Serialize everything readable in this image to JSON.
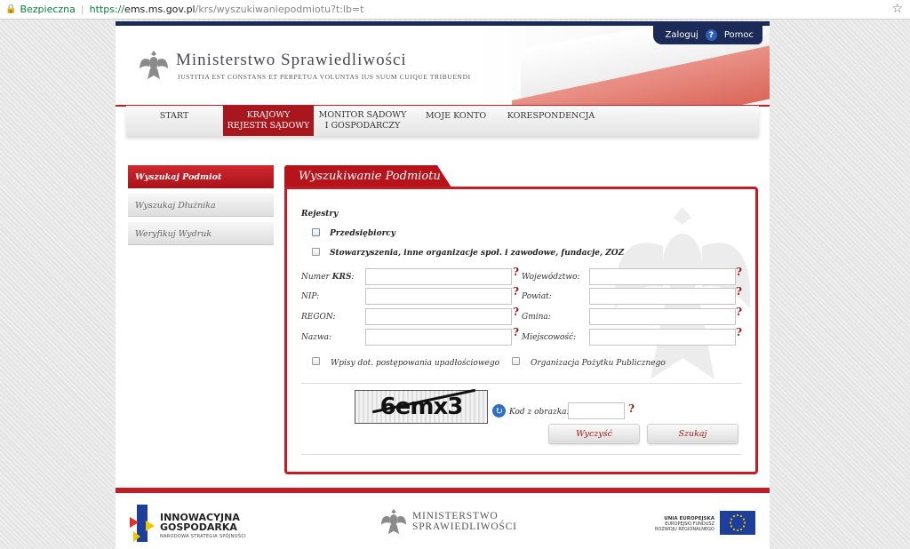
{
  "browser": {
    "secure_label": "Bezpieczna",
    "url_protocol": "https://",
    "url_host": "ems.ms.gov.pl",
    "url_path": "/krs/wyszukiwaniepodmiotu?t:lb=t"
  },
  "header": {
    "title": "Ministerstwo Sprawiedliwości",
    "motto": "IUSTITIA EST CONSTANS ET PERPETUA VOLUNTAS IUS SUUM CUIQUE TRIBUENDI",
    "login_label": "Zaloguj",
    "help_icon_glyph": "?",
    "help_label": "Pomoc"
  },
  "nav": {
    "items": [
      {
        "line1": "START",
        "line2": ""
      },
      {
        "line1": "KRAJOWY",
        "line2": "REJESTR SĄDOWY"
      },
      {
        "line1": "MONITOR SĄDOWY",
        "line2": "I GOSPODARCZY"
      },
      {
        "line1": "MOJE KONTO",
        "line2": ""
      },
      {
        "line1": "KORESPONDENCJA",
        "line2": ""
      }
    ]
  },
  "sidebar": {
    "items": [
      {
        "label": "Wyszukaj Podmiot"
      },
      {
        "label": "Wyszukaj Dłużnika"
      },
      {
        "label": "Weryfikuj Wydruk"
      }
    ]
  },
  "panel": {
    "title": "Wyszukiwanie Podmiotu",
    "registers_label": "Rejestry",
    "register_options": [
      {
        "label": "Przedsiębiorcy",
        "checked": false
      },
      {
        "label": "Stowarzyszenia, inne organizacje społ. i zawodowe, fundacje, ZOZ",
        "checked": false
      }
    ],
    "fields_left": [
      {
        "label_prefix": "Numer ",
        "label_bold": "KRS",
        "label_suffix": ":",
        "value": ""
      },
      {
        "label_prefix": "NIP:",
        "label_bold": "",
        "label_suffix": "",
        "value": ""
      },
      {
        "label_prefix": "REGON:",
        "label_bold": "",
        "label_suffix": "",
        "value": ""
      },
      {
        "label_prefix": "Nazwa:",
        "label_bold": "",
        "label_suffix": "",
        "value": ""
      }
    ],
    "fields_right": [
      {
        "label": "Województwo:",
        "value": ""
      },
      {
        "label": "Powiat:",
        "value": ""
      },
      {
        "label": "Gmina:",
        "value": ""
      },
      {
        "label": "Miejscowość:",
        "value": ""
      }
    ],
    "help_mark": "?",
    "extra_options": [
      {
        "label": "Wpisy dot. postępowania upadłościowego",
        "checked": false
      },
      {
        "label": "Organizacja Pożytku Publicznego",
        "checked": false
      }
    ],
    "captcha_text": "6emx3",
    "refresh_glyph": "↻",
    "code_label": "Kod z obrazka:",
    "code_value": "",
    "clear_button": "Wyczyść",
    "search_button": "Szukaj"
  },
  "footer": {
    "ig_title_line1": "INNOWACYJNA",
    "ig_title_line2": "GOSPODARKA",
    "ig_subtitle": "NARODOWA STRATEGIA SPÓJNOŚCI",
    "ms_line1": "Ministerstwo",
    "ms_line2": "Sprawiedliwości",
    "eu_line1": "UNIA EUROPEJSKA",
    "eu_line2": "EUROPEJSKI FUNDUSZ",
    "eu_line3": "ROZWOJU REGIONALNEGO"
  },
  "colors": {
    "brand_red": "#c41b24",
    "brand_navy": "#1b2a56",
    "secure_green": "#0b8043"
  }
}
